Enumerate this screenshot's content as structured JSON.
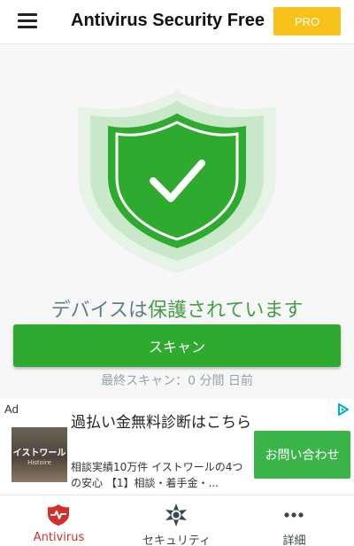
{
  "colors": {
    "accent_green": "#2eaa2e",
    "pro_yellow": "#f8c21a",
    "status_gray": "#607d8b",
    "nav_active_red": "#d32f2f",
    "nav_inactive": "#37474f"
  },
  "header": {
    "menu_icon": "hamburger-menu-icon",
    "title": "Antivirus Security Free",
    "pro_label": "PRO"
  },
  "shield": {
    "icon": "shield-check-icon"
  },
  "status": {
    "prefix": "デバイスは",
    "state": "保護されています"
  },
  "scan": {
    "button_label": "スキャン",
    "last_scan_text": "最終スキャン：0 分間 日前"
  },
  "ad": {
    "label": "Ad",
    "choices_icon": "adchoices-icon",
    "thumb_text": "イストワール",
    "thumb_sub": "Histoire",
    "headline": "過払い金無料診断はこちら",
    "body": "相談実績10万件 イストワールの4つの安心 【1】相談・着手金・...",
    "cta_label": "お問い合わせ"
  },
  "nav": {
    "items": [
      {
        "label": "Antivirus",
        "icon": "shield-pulse-icon",
        "active": true
      },
      {
        "label": "セキュリティ",
        "icon": "sheriff-star-icon",
        "active": false
      },
      {
        "label": "詳細",
        "icon": "more-dots-icon",
        "active": false
      }
    ]
  }
}
